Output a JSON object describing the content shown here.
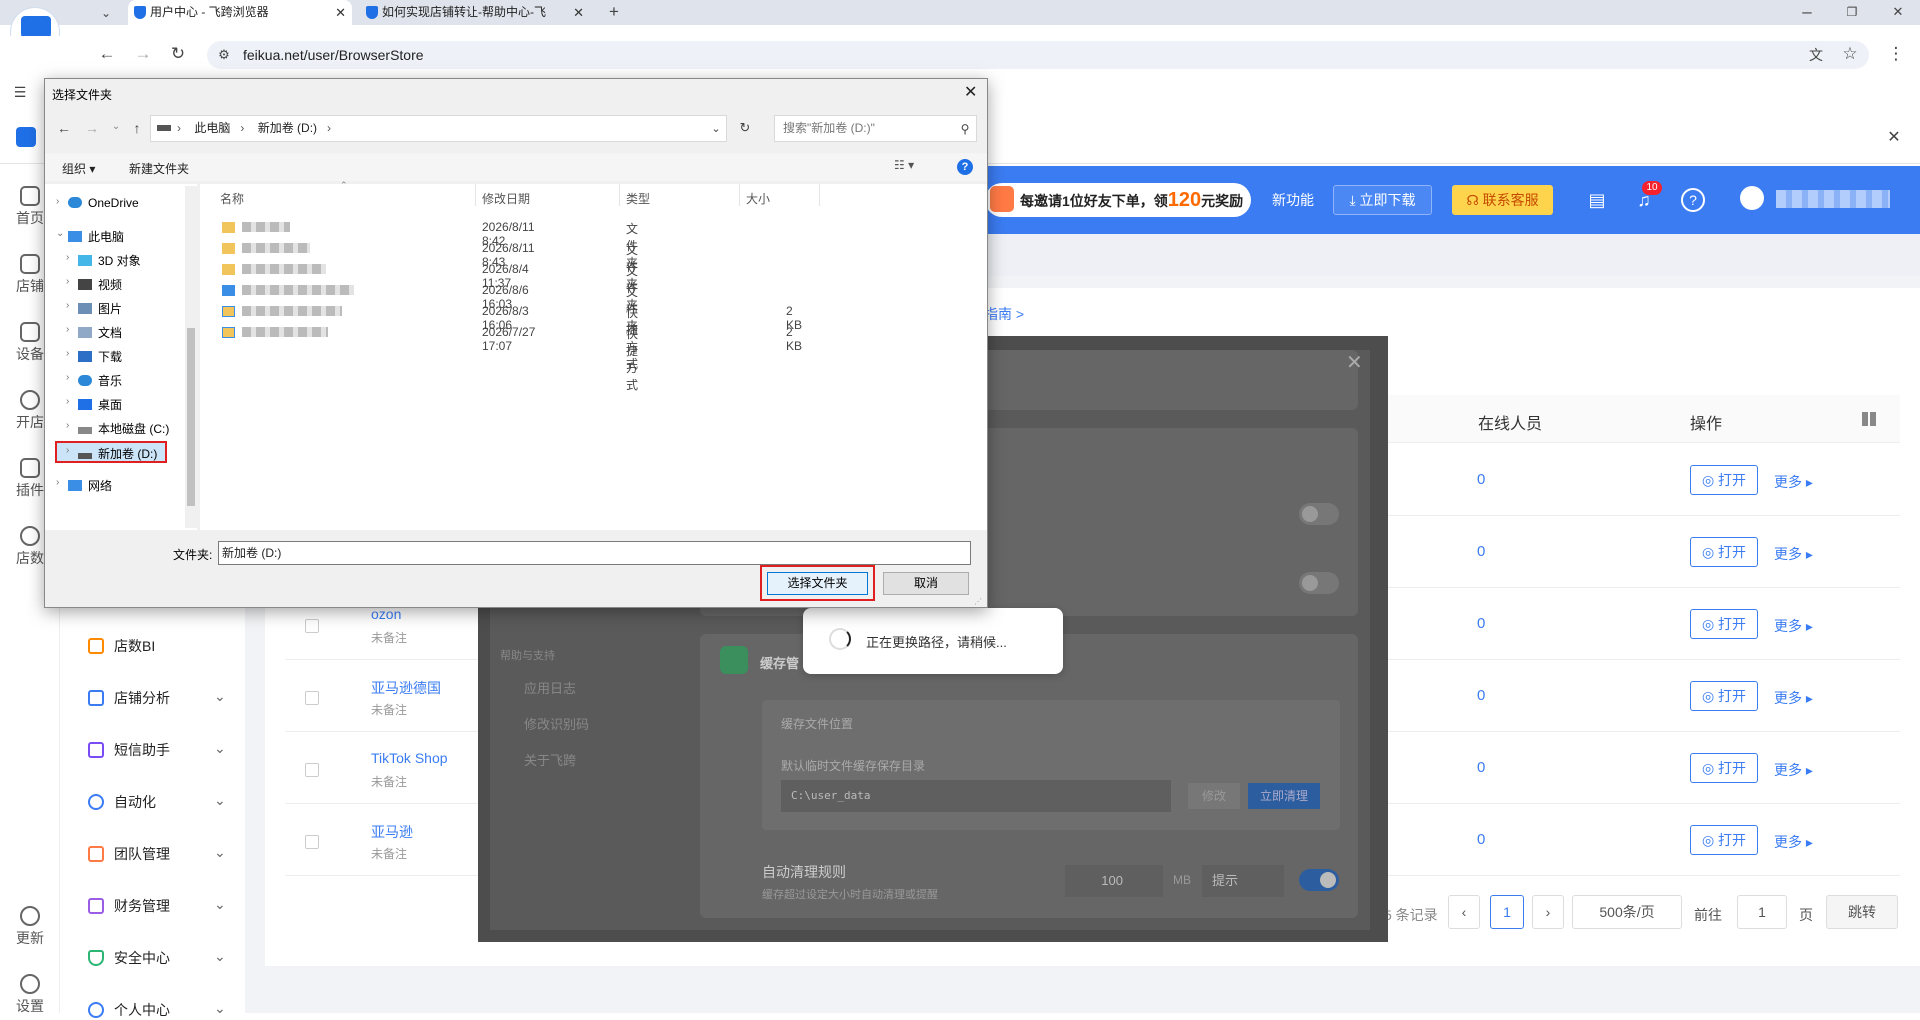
{
  "browser": {
    "tabs": [
      {
        "label": "用户中心 - 飞跨浏览器",
        "active": true
      },
      {
        "label": "如何实现店铺转让-帮助中心-飞",
        "active": false
      }
    ],
    "url": "feikua.net/user/BrowserStore"
  },
  "header": {
    "promo_prefix": "每邀请1位好友下单，领",
    "promo_amount": "120",
    "promo_suffix": "元奖励",
    "new_feature": "新功能",
    "download": "立即下载",
    "service": "联系客服",
    "notification_count": "10"
  },
  "left_nav": [
    {
      "label": "首页",
      "icon": "home-icon"
    },
    {
      "label": "店铺",
      "icon": "shop-icon"
    },
    {
      "label": "设备",
      "icon": "layers-icon"
    },
    {
      "label": "开店",
      "icon": "planet-icon"
    },
    {
      "label": "插件",
      "icon": "puzzle-icon"
    },
    {
      "label": "店数",
      "icon": "bi-icon"
    },
    {
      "label": "更新",
      "icon": "cloud-download-icon"
    },
    {
      "label": "设置",
      "icon": "settings-icon"
    }
  ],
  "side_menu": [
    {
      "label": "店数BI",
      "has_chevron": false
    },
    {
      "label": "店铺分析",
      "has_chevron": true
    },
    {
      "label": "短信助手",
      "has_chevron": true
    },
    {
      "label": "自动化",
      "has_chevron": true
    },
    {
      "label": "团队管理",
      "has_chevron": true
    },
    {
      "label": "财务管理",
      "has_chevron": true
    },
    {
      "label": "安全中心",
      "has_chevron": true
    },
    {
      "label": "个人中心",
      "has_chevron": true
    }
  ],
  "guide_link": "指南 >",
  "table": {
    "headers": {
      "online": "在线人员",
      "actions": "操作"
    },
    "rows": [
      {
        "name": "",
        "note": "",
        "online": "0"
      },
      {
        "name": "",
        "note": "",
        "online": "0"
      },
      {
        "name": "ozon",
        "note": "未备注",
        "online": "0"
      },
      {
        "name": "亚马逊德国",
        "note": "未备注",
        "online": "0"
      },
      {
        "name": "TikTok Shop",
        "note": "未备注",
        "online": "0"
      },
      {
        "name": "亚马逊",
        "note": "未备注",
        "online": "0"
      }
    ],
    "open_label": "打开",
    "more_label": "更多"
  },
  "pagination": {
    "records_suffix": "5 条记录",
    "current_page": "1",
    "page_size": "500条/页",
    "goto_label": "前往",
    "goto_value": "1",
    "page_unit": "页",
    "jump_label": "跳转"
  },
  "settings_modal": {
    "side_items": [
      "帮助与支持",
      "应用日志",
      "修改识别码",
      "关于飞跨"
    ],
    "cache_title": "缓存管",
    "cache_location_label": "缓存文件位置",
    "cache_desc": "默认临时文件缓存保存目录",
    "cache_path": "C:\\user_data",
    "modify_label": "修改",
    "clean_label": "立即清理",
    "auto_clean_title": "自动清理规则",
    "auto_clean_desc": "缓存超过设定大小时自动清理或提醒",
    "size_value": "100",
    "size_unit": "MB",
    "mode_value": "提示"
  },
  "loading_text": "正在更换路径，请稍候...",
  "file_dialog": {
    "title": "选择文件夹",
    "breadcrumb": [
      "此电脑",
      "新加卷 (D:)"
    ],
    "search_placeholder": "搜索\"新加卷 (D:)\"",
    "organize": "组织",
    "new_folder": "新建文件夹",
    "tree": [
      {
        "label": "OneDrive",
        "indent": 0
      },
      {
        "label": "此电脑",
        "indent": 0
      },
      {
        "label": "3D 对象",
        "indent": 1
      },
      {
        "label": "视频",
        "indent": 1
      },
      {
        "label": "图片",
        "indent": 1
      },
      {
        "label": "文档",
        "indent": 1
      },
      {
        "label": "下载",
        "indent": 1
      },
      {
        "label": "音乐",
        "indent": 1
      },
      {
        "label": "桌面",
        "indent": 1
      },
      {
        "label": "本地磁盘 (C:)",
        "indent": 1
      },
      {
        "label": "新加卷 (D:)",
        "indent": 1
      },
      {
        "label": "网络",
        "indent": 0
      }
    ],
    "columns": {
      "name": "名称",
      "date": "修改日期",
      "type": "类型",
      "size": "大小"
    },
    "files": [
      {
        "date": "2026/8/11 8:42",
        "type": "文件夹",
        "size": ""
      },
      {
        "date": "2026/8/11 8:43",
        "type": "文件夹",
        "size": ""
      },
      {
        "date": "2026/8/4 11:37",
        "type": "文件夹",
        "size": ""
      },
      {
        "date": "2026/8/6 16:03",
        "type": "文件夹",
        "size": ""
      },
      {
        "date": "2026/8/3 16:06",
        "type": "快捷方式",
        "size": "2 KB"
      },
      {
        "date": "2026/7/27 17:07",
        "type": "快捷方式",
        "size": "2 KB"
      }
    ],
    "folder_label": "文件夹:",
    "folder_value": "新加卷 (D:)",
    "select_button": "选择文件夹",
    "cancel_button": "取消"
  }
}
